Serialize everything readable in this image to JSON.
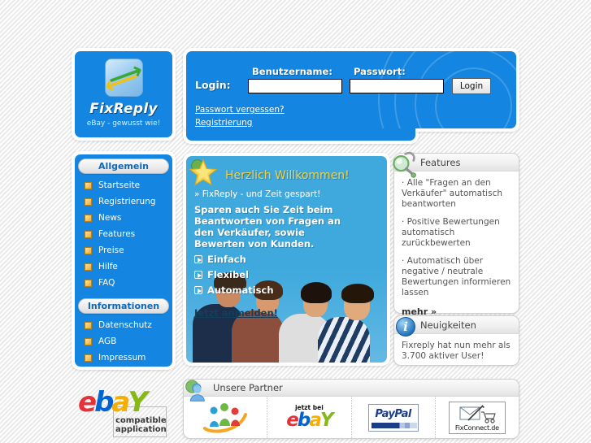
{
  "brand": {
    "logo_title": "FixReply",
    "logo_tagline": "eBay - gewusst wie!",
    "logo_icon": "two-arrows-refresh-icon"
  },
  "login": {
    "label": "Login:",
    "username_label": "Benutzername:",
    "password_label": "Passwort:",
    "username_value": "",
    "password_value": "",
    "username_placeholder": "",
    "password_placeholder": "",
    "submit_label": "Login",
    "forgot_link": "Passwort vergessen?",
    "register_link": "Registrierung"
  },
  "sidebar": {
    "sections": [
      {
        "title": "Allgemein",
        "items": [
          {
            "label": "Startseite"
          },
          {
            "label": "Registrierung"
          },
          {
            "label": "News"
          },
          {
            "label": "Features"
          },
          {
            "label": "Preise"
          },
          {
            "label": "Hilfe"
          },
          {
            "label": "FAQ"
          }
        ]
      },
      {
        "title": "Informationen",
        "items": [
          {
            "label": "Datenschutz"
          },
          {
            "label": "AGB"
          },
          {
            "label": "Impressum"
          }
        ]
      }
    ]
  },
  "ebay_badge": {
    "logo_e": "e",
    "logo_b": "b",
    "logo_a": "a",
    "logo_y": "Y",
    "line1": "compatible",
    "line2": "application"
  },
  "welcome": {
    "icon": "star-icon",
    "title": "Herzlich Willkommen!",
    "subtitle": "» FixReply - und Zeit gespart!",
    "body": "Sparen auch Sie Zeit beim Beantworten von Fragen an den Verkäufer, sowie Bewerten von Kunden.",
    "bullets": [
      {
        "label": "Einfach"
      },
      {
        "label": "Flexibel"
      },
      {
        "label": "Automatisch"
      }
    ],
    "cta": "Jetzt anmelden!"
  },
  "features": {
    "icon": "magnifier-icon",
    "title": "Features",
    "items": [
      {
        "text": "· Alle \"Fragen an den Verkäufer\" automatisch beantworten"
      },
      {
        "text": "· Positive Bewertungen automatisch zurückbewerten"
      },
      {
        "text": "· Automatisch über negative / neutrale Bewertungen informieren lassen"
      }
    ],
    "more_label": "mehr »"
  },
  "news": {
    "icon": "info-icon",
    "title": "Neuigkeiten",
    "text": "Fixreply hat nun mehr als 3.700 aktiver User!"
  },
  "partners": {
    "icon": "people-icon",
    "title": "Unsere Partner",
    "items": [
      {
        "name": "community-swoosh-logo",
        "label": ""
      },
      {
        "name": "jetzt-bei-ebay-logo",
        "label_top": "jetzt bei",
        "logo_e": "e",
        "logo_b": "b",
        "logo_a": "a",
        "logo_y": "Y"
      },
      {
        "name": "paypal-logo",
        "label": "PayPal"
      },
      {
        "name": "fixconnect-logo",
        "label": "FixConnect.de"
      }
    ]
  },
  "colors": {
    "brand_blue": "#1485e0",
    "panel_blue": "#3fa9dd",
    "accent_yellow": "#f7d23e",
    "header_text": "#444444"
  }
}
